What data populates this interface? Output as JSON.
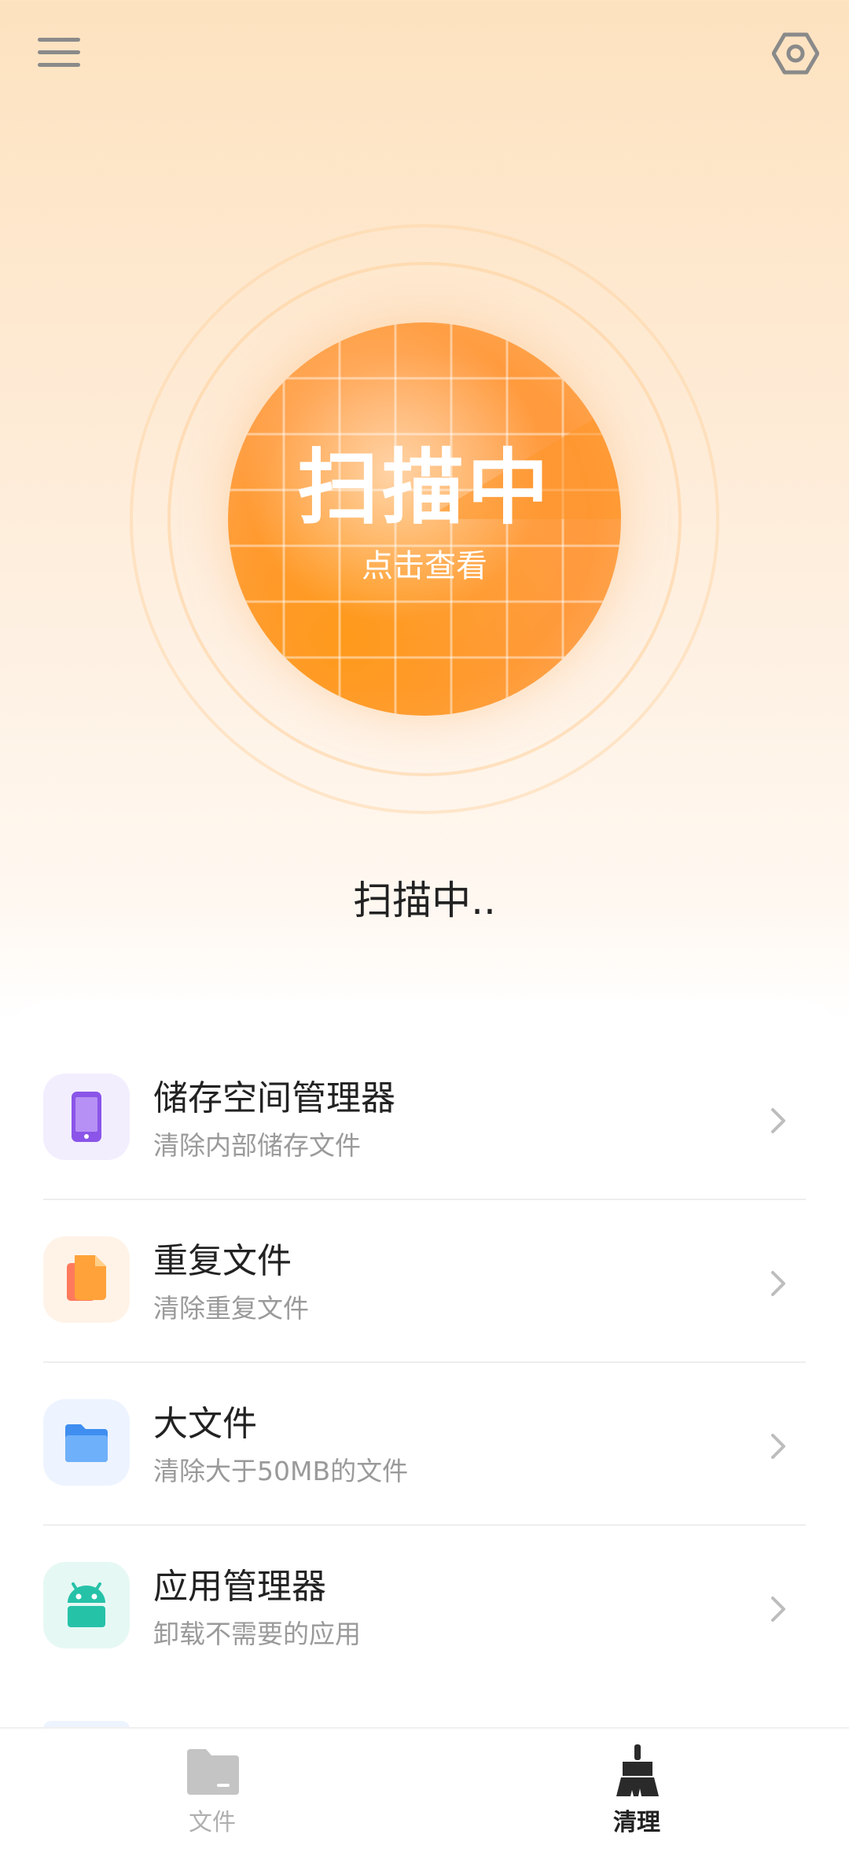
{
  "header": {
    "menu_icon": "hamburger-menu-icon",
    "settings_icon": "settings-gear-icon"
  },
  "scanner": {
    "title": "扫描中",
    "subtitle": "点击查看"
  },
  "status_text": "扫描中..",
  "tools": [
    {
      "title": "储存空间管理器",
      "desc": "清除内部储存文件",
      "icon": "phone-icon",
      "icon_bg": "#f3eefe",
      "icon_color": "#8a55e8"
    },
    {
      "title": "重复文件",
      "desc": "清除重复文件",
      "icon": "duplicate-file-icon",
      "icon_bg": "#fff3e8",
      "icon_color": "#ff8a3d"
    },
    {
      "title": "大文件",
      "desc": "清除大于50MB的文件",
      "icon": "folder-icon",
      "icon_bg": "#edf4ff",
      "icon_color": "#4a96f5"
    },
    {
      "title": "应用管理器",
      "desc": "卸载不需要的应用",
      "icon": "android-icon",
      "icon_bg": "#e6f8f4",
      "icon_color": "#26c2a8"
    }
  ],
  "bottom_nav": [
    {
      "label": "文件",
      "icon": "folder-tab-icon",
      "active": false
    },
    {
      "label": "清理",
      "icon": "broom-tab-icon",
      "active": true
    }
  ],
  "colors": {
    "accent_orange": "#ff9a3d",
    "nav_active": "#222222",
    "nav_inactive": "#b0b0b0"
  }
}
